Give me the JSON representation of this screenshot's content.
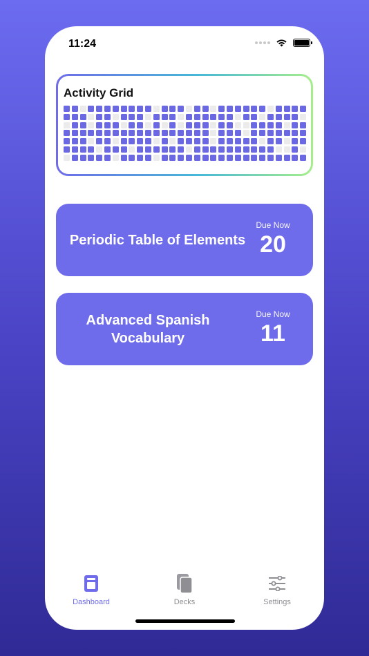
{
  "status_bar": {
    "time": "11:24"
  },
  "activity": {
    "title": "Activity Grid",
    "grid": [
      "110111111110111011011111101111",
      "111011011101110111111011011110",
      "011011101101010111011001111011",
      "111111111111111111011101111111",
      "111011011110101111011111011011",
      "111101110111111011111111110010",
      "011111011110111111111111111111"
    ]
  },
  "decks": [
    {
      "name": "Periodic Table of Elements",
      "due_label": "Due Now",
      "due_count": "20"
    },
    {
      "name": "Advanced Spanish Vocabulary",
      "due_label": "Due Now",
      "due_count": "11"
    }
  ],
  "tabs": [
    {
      "label": "Dashboard",
      "icon": "dashboard-icon",
      "active": true
    },
    {
      "label": "Decks",
      "icon": "decks-icon",
      "active": false
    },
    {
      "label": "Settings",
      "icon": "settings-sliders-icon",
      "active": false
    }
  ],
  "colors": {
    "accent": "#6f6ceb",
    "grid_on": "#6b68e4",
    "grid_off": "#ebebeb",
    "tab_inactive": "#8e8e93"
  }
}
